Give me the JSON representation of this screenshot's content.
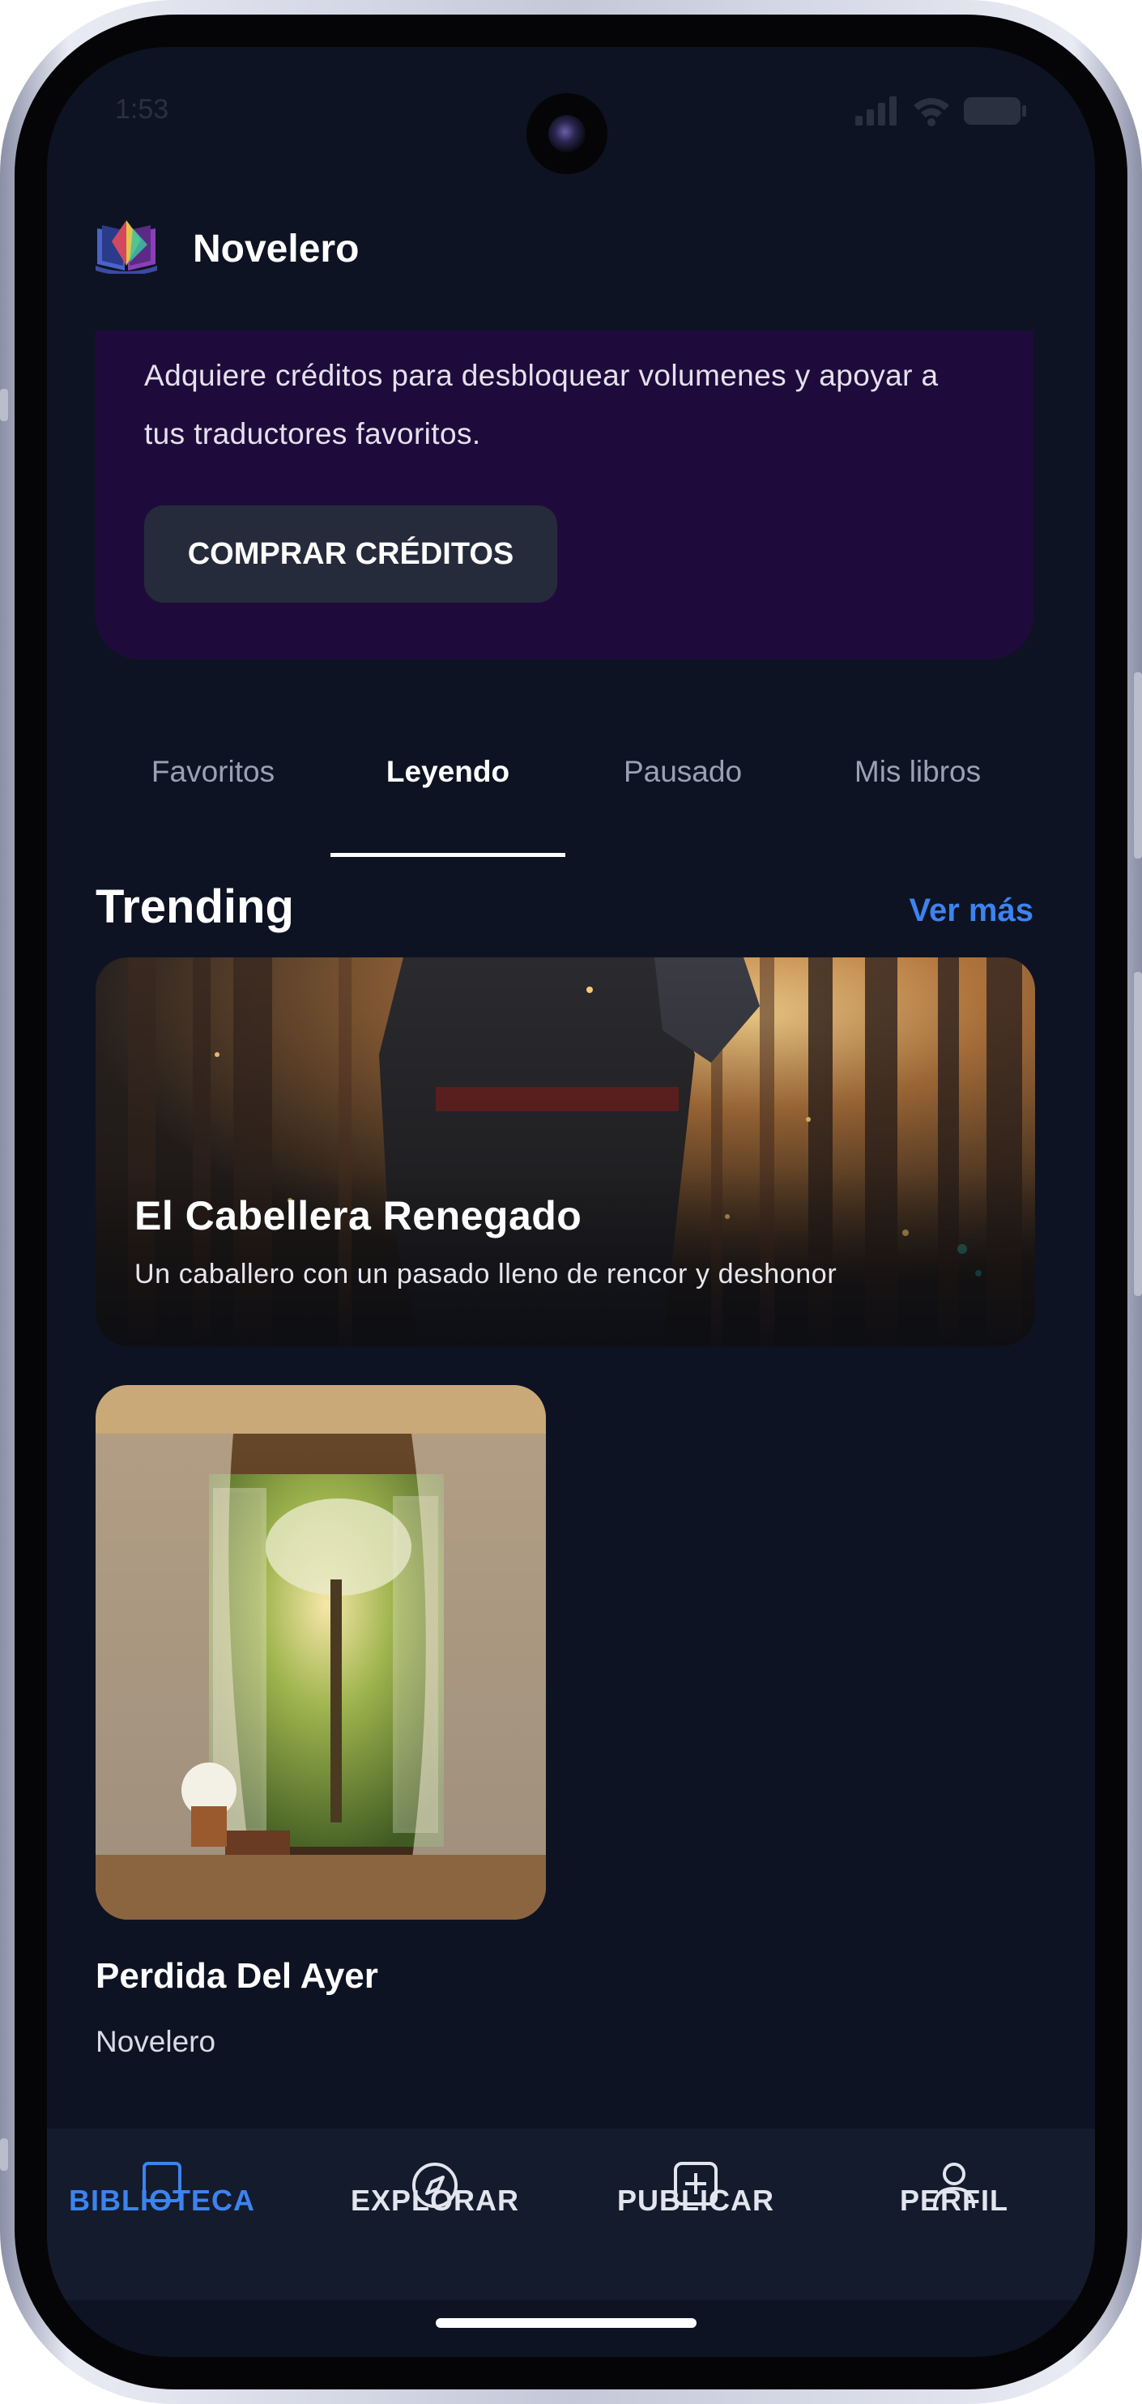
{
  "status_bar": {
    "time": "1:53"
  },
  "app": {
    "title": "Novelero"
  },
  "promo": {
    "text": "Adquiere créditos para desbloquear volumenes y apoyar a tus traductores favoritos.",
    "button_label": "COMPRAR CRÉDITOS"
  },
  "tabs": [
    {
      "label": "Favoritos",
      "active": false
    },
    {
      "label": "Leyendo",
      "active": true
    },
    {
      "label": "Pausado",
      "active": false
    },
    {
      "label": "Mis libros",
      "active": false
    }
  ],
  "trending": {
    "title": "Trending",
    "see_more": "Ver más",
    "featured": {
      "title": "El Cabellera Renegado",
      "subtitle": "Un caballero con un pasado lleno de rencor  y deshonor"
    }
  },
  "books": [
    {
      "title": "Perdida Del Ayer",
      "author": "Novelero"
    }
  ],
  "bottom_nav": [
    {
      "label": "BIBLIOTECA",
      "icon": "book-icon",
      "active": true
    },
    {
      "label": "EXPLORAR",
      "icon": "compass-icon",
      "active": false
    },
    {
      "label": "PUBLICAR",
      "icon": "add-square-icon",
      "active": false
    },
    {
      "label": "PERFIL",
      "icon": "person-icon",
      "active": false
    }
  ],
  "colors": {
    "background": "#0d1322",
    "promo": "#1f0b3b",
    "accent": "#3d83ef",
    "nav": "#141b2c"
  }
}
